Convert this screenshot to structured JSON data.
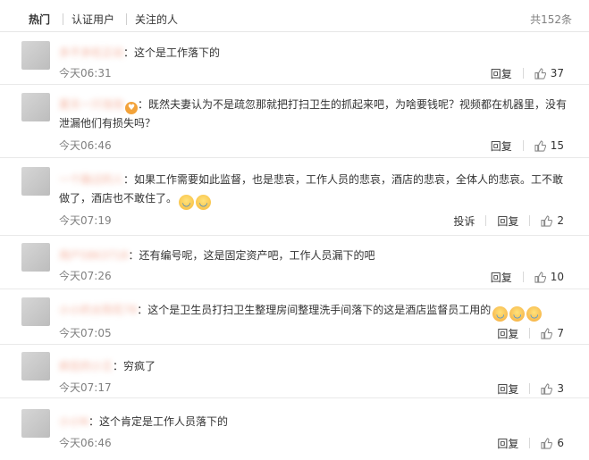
{
  "tabs": [
    {
      "label": "热门"
    },
    {
      "label": "认证用户"
    },
    {
      "label": "关注的人"
    }
  ],
  "total_label": "共152条",
  "actions": {
    "reply": "回复",
    "report": "投诉"
  },
  "comments": [
    {
      "username": "多不多旺正动",
      "text": "这个是工作落下的",
      "time": "今天06:31",
      "likes": "37"
    },
    {
      "username": "夏天一只泡泡",
      "text": "既然夫妻认为不是疏忽那就把打扫卫生的抓起来吧，为啥要钱呢？视频都在机器里，没有泄漏他们有损失吗？",
      "time": "今天06:46",
      "likes": "15"
    },
    {
      "username": "一个路过的人",
      "text": "如果工作需要如此监督，也是悲哀，工作人员的悲哀，酒店的悲哀，全体人的悲哀。工不敢做了，酒店也不敢住了。",
      "time": "今天07:19",
      "likes": "2"
    },
    {
      "username": "用户5863718",
      "text": "还有编号呢，这是固定资产吧，工作人员漏下的吧",
      "time": "今天07:26",
      "likes": "10"
    },
    {
      "username": "小小的太阳花78",
      "text": "这个是卫生员打扫卫生整理房间整理洗手间落下的这是酒店监督员工用的",
      "time": "今天07:05",
      "likes": "7"
    },
    {
      "username": "疯狂的小王",
      "text": "穷疯了",
      "time": "今天07:17",
      "likes": "3"
    },
    {
      "username": "小小N",
      "text": "这个肯定是工作人员落下的",
      "time": "今天06:46",
      "likes": "6"
    }
  ],
  "colors": {
    "username": "#eb7350",
    "muted": "#808080",
    "divider": "#e9e9e9"
  }
}
